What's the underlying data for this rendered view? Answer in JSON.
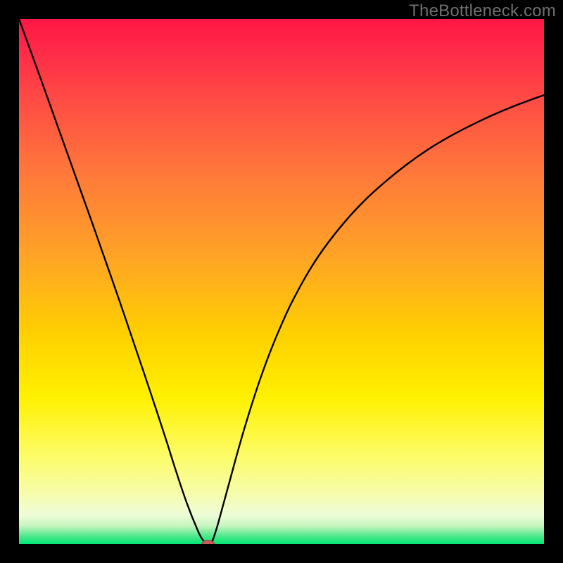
{
  "watermark": "TheBottleneck.com",
  "colors": {
    "frame": "#000000",
    "curve": "#000000",
    "marker_fill": "#c85a5a",
    "marker_stroke": "#8b3a3a",
    "gradient_stops": [
      {
        "pos": 0.0,
        "color": "#ff1744"
      },
      {
        "pos": 0.06,
        "color": "#ff2a48"
      },
      {
        "pos": 0.15,
        "color": "#ff4a45"
      },
      {
        "pos": 0.3,
        "color": "#ff7a3a"
      },
      {
        "pos": 0.45,
        "color": "#ffa326"
      },
      {
        "pos": 0.6,
        "color": "#ffd000"
      },
      {
        "pos": 0.72,
        "color": "#fff000"
      },
      {
        "pos": 0.83,
        "color": "#fdfc66"
      },
      {
        "pos": 0.9,
        "color": "#f6fca8"
      },
      {
        "pos": 0.945,
        "color": "#eefcd8"
      },
      {
        "pos": 0.965,
        "color": "#c9f5c0"
      },
      {
        "pos": 0.985,
        "color": "#4fe88a"
      },
      {
        "pos": 1.0,
        "color": "#00e677"
      }
    ]
  },
  "chart_data": {
    "type": "line",
    "title": "",
    "xlabel": "",
    "ylabel": "",
    "xlim": [
      0,
      100
    ],
    "ylim": [
      0,
      100
    ],
    "grid": false,
    "legend": false,
    "x": [
      0,
      2,
      4,
      6,
      8,
      10,
      12,
      14,
      16,
      18,
      20,
      22,
      24,
      26,
      28,
      30,
      32,
      34,
      35,
      36,
      36.5,
      37,
      38,
      40,
      42,
      44,
      46,
      48,
      50,
      52,
      55,
      58,
      62,
      66,
      70,
      74,
      78,
      82,
      86,
      90,
      94,
      98,
      100
    ],
    "values": [
      100,
      94.5,
      89,
      83.4,
      77.8,
      72.2,
      66.6,
      61,
      55.3,
      49.6,
      43.8,
      37.9,
      32,
      26,
      19.9,
      13.6,
      7.7,
      2.7,
      0.8,
      0,
      0.1,
      1,
      4.2,
      11.5,
      18.8,
      25.5,
      31.6,
      37,
      41.8,
      46.1,
      51.6,
      56.2,
      61.3,
      65.6,
      69.2,
      72.4,
      75.2,
      77.6,
      79.7,
      81.6,
      83.3,
      84.8,
      85.5
    ],
    "marker": {
      "x": 36,
      "y": 0,
      "rx": 1.2,
      "ry": 0.7
    },
    "annotations": []
  }
}
